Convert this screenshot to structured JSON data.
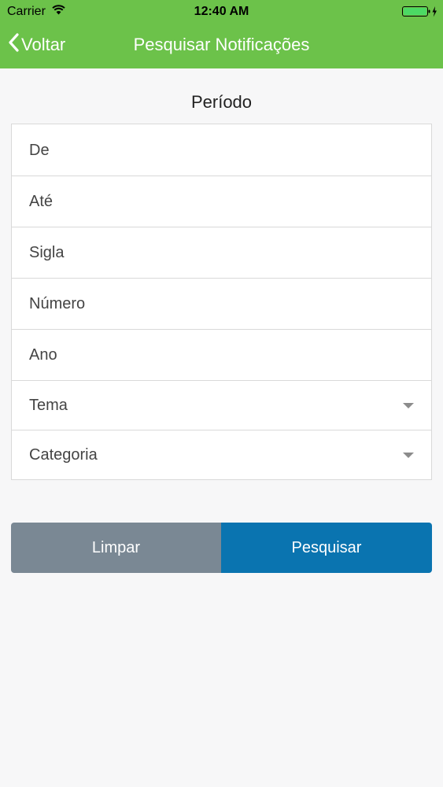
{
  "status_bar": {
    "carrier": "Carrier",
    "time": "12:40 AM",
    "wifi_icon": "wifi-icon",
    "battery_icon": "battery-charging-icon"
  },
  "nav": {
    "back_label": "Voltar",
    "back_icon": "chevron-left-icon",
    "title": "Pesquisar Notificações"
  },
  "form": {
    "section_title": "Período",
    "fields": [
      {
        "label": "De"
      },
      {
        "label": "Até"
      },
      {
        "label": "Sigla"
      },
      {
        "label": "Número"
      },
      {
        "label": "Ano"
      },
      {
        "label": "Tema",
        "icon": "caret-down-icon"
      },
      {
        "label": "Categoria",
        "icon": "caret-down-icon"
      }
    ]
  },
  "actions": {
    "clear_label": "Limpar",
    "search_label": "Pesquisar"
  },
  "colors": {
    "header": "#6cc24a",
    "clear_button": "#7a8894",
    "search_button": "#0a74b0",
    "battery": "#4cd964"
  }
}
